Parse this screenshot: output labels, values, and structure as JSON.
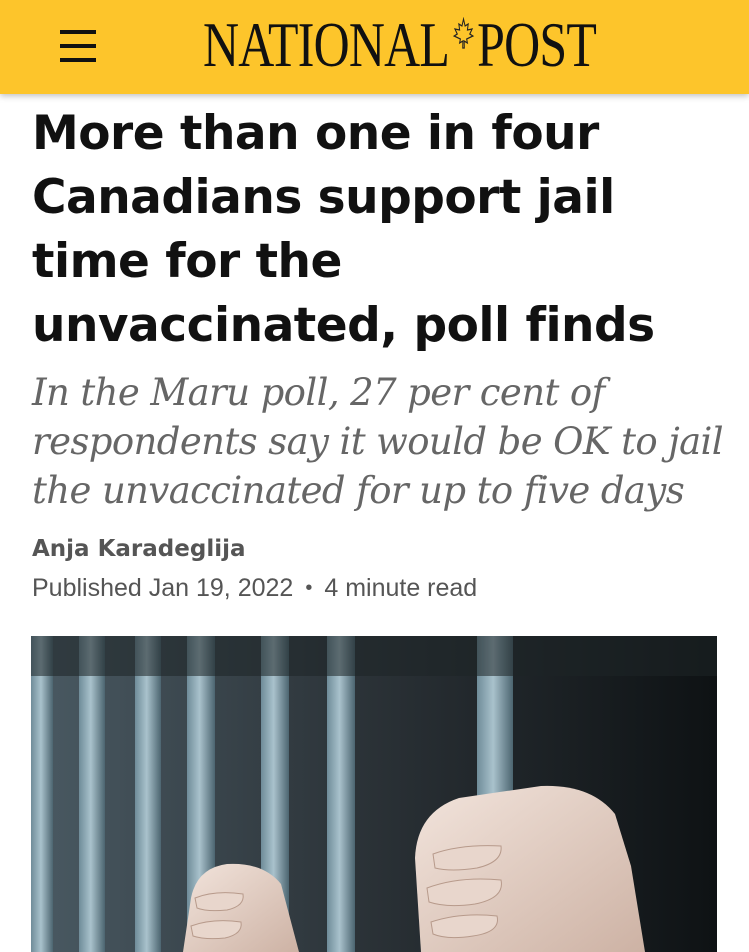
{
  "header": {
    "brand_left": "NATIONAL",
    "brand_right": "POST",
    "menu_icon": "hamburger-menu-icon",
    "logo_icon": "maple-leaf-icon",
    "background_color": "#fdc52b"
  },
  "article": {
    "headline": "More than one in four Canadians support jail time for the unvaccinated, poll finds",
    "subheadline": "In the Maru poll, 27 per cent of respondents say it would be OK to jail the unvaccinated for up to five days",
    "author": "Anja Karadeglija",
    "published": "Published Jan 19, 2022",
    "separator": "•",
    "read_time": "4 minute read"
  }
}
